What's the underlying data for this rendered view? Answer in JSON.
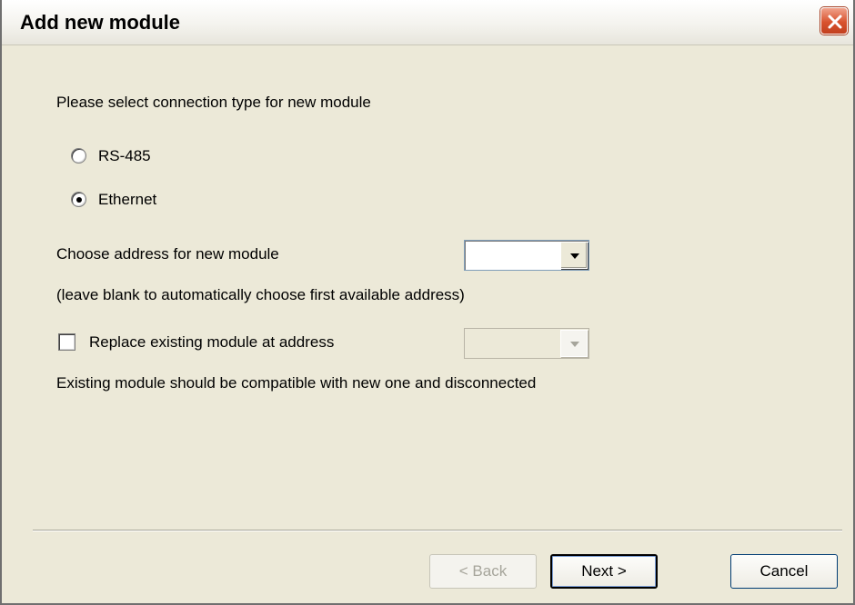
{
  "window": {
    "title": "Add new module"
  },
  "connection": {
    "prompt": "Please select connection type for new module",
    "options": [
      {
        "label": "RS-485",
        "selected": false
      },
      {
        "label": "Ethernet",
        "selected": true
      }
    ]
  },
  "address": {
    "label": "Choose address for new module",
    "value": "",
    "hint": "(leave blank to automatically choose first available address)"
  },
  "replace": {
    "label": "Replace existing module at address",
    "checked": false,
    "value": "",
    "note": "Existing module should be compatible with new one and disconnected"
  },
  "buttons": {
    "back": "< Back",
    "next": "Next >",
    "cancel": "Cancel"
  },
  "icons": {
    "close": "close-icon",
    "dropdown": "chevron-down-icon"
  },
  "colors": {
    "dialog_background": "#ECE9D8",
    "close_button": "#D9532E"
  }
}
